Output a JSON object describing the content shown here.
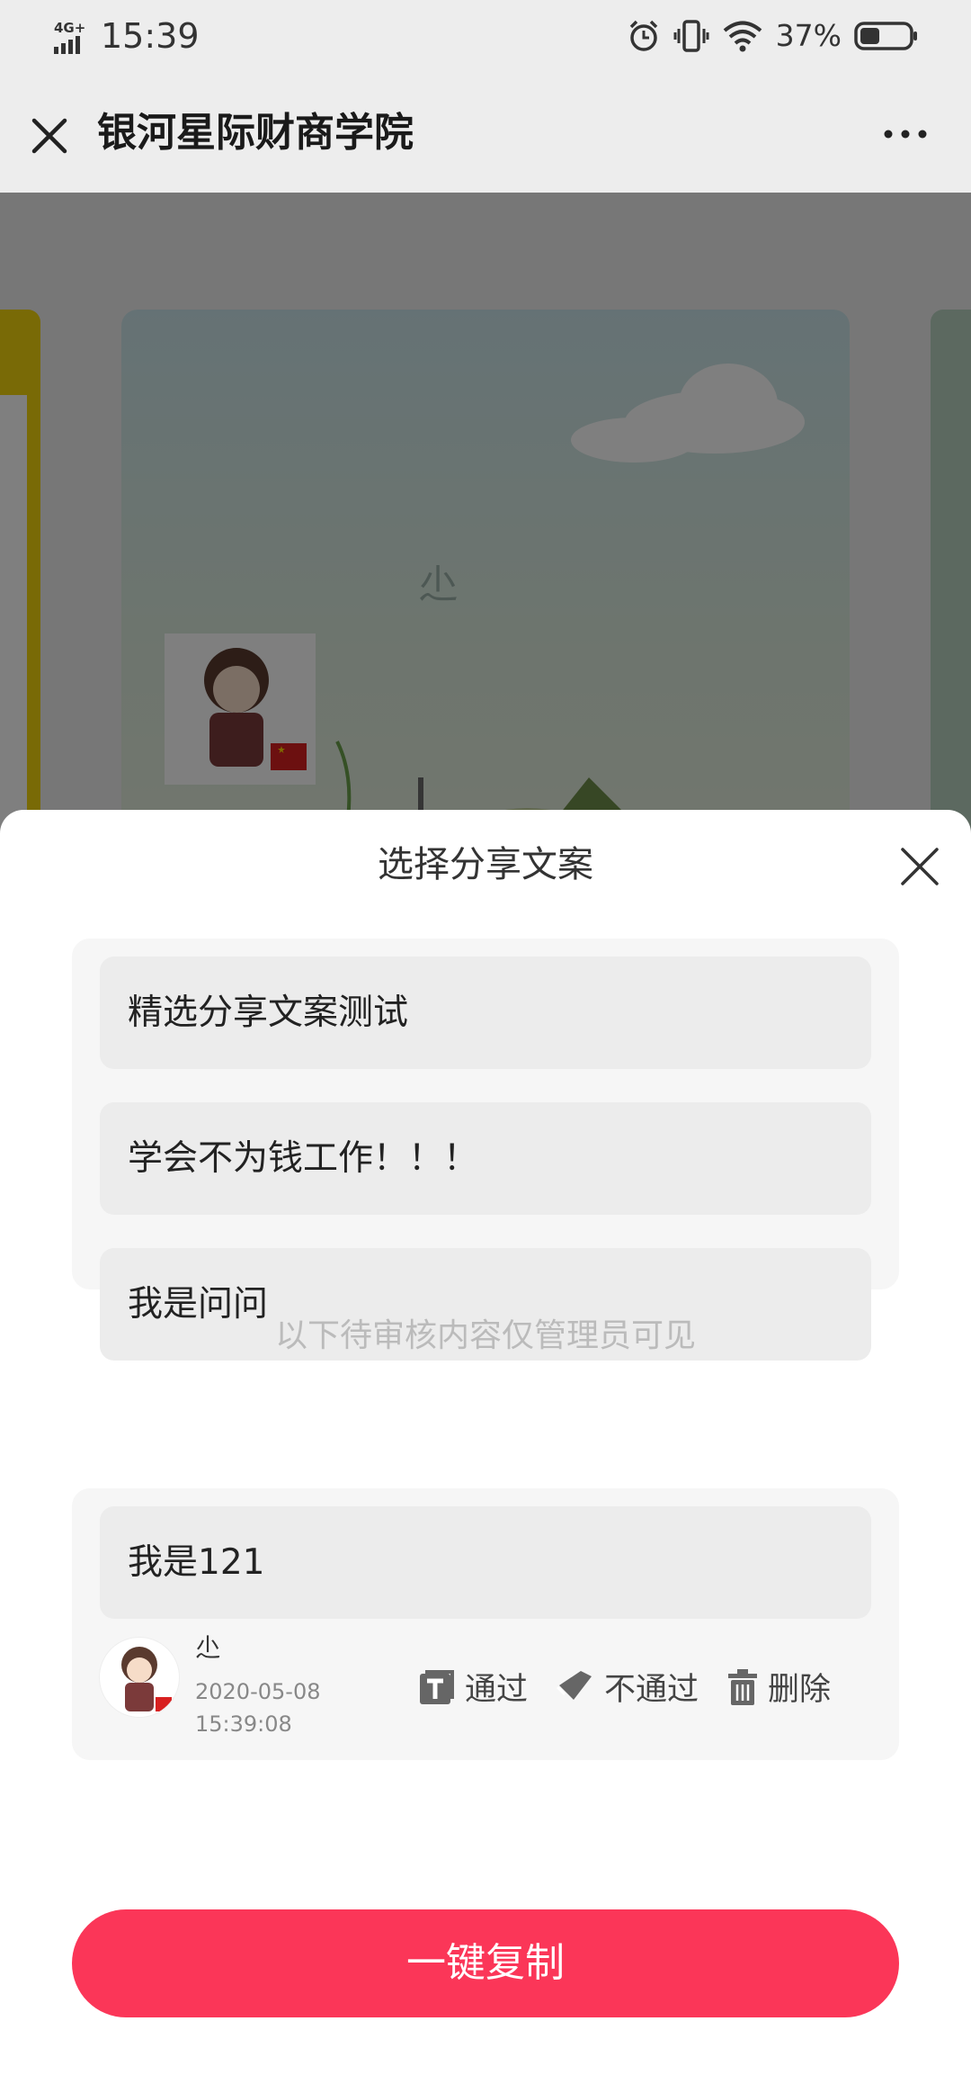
{
  "status_bar": {
    "network": "4G+",
    "time": "15:39",
    "battery": "37%",
    "icons": [
      "signal-icon",
      "alarm-icon",
      "vibrate-icon",
      "wifi-icon",
      "battery-icon"
    ]
  },
  "header": {
    "title": "银河星际财商学院",
    "close_icon": "close-icon",
    "more_icon": "more-icon"
  },
  "background_card": {
    "nickname": "尐"
  },
  "sheet": {
    "title": "选择分享文案",
    "options": [
      "精选分享文案测试",
      "学会不为钱工作！！！",
      "我是问问"
    ],
    "pending_note": "以下待审核内容仅管理员可见",
    "pending": {
      "text": "我是121",
      "author": "尐",
      "date": "2020-05-08",
      "time": "15:39:08",
      "actions": {
        "approve": "通过",
        "reject": "不通过",
        "delete": "删除"
      }
    },
    "copy_button": "一键复制"
  },
  "colors": {
    "accent": "#fb3658",
    "sheet_bg": "#ffffff",
    "option_bg": "#ececec"
  }
}
